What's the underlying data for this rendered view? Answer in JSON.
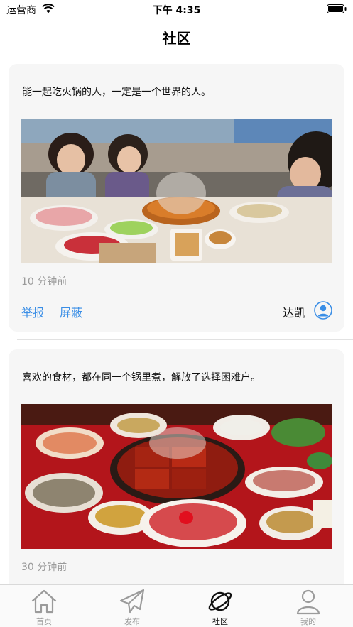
{
  "status_bar": {
    "carrier": "运营商",
    "time": "下午 4:35"
  },
  "nav": {
    "title": "社区"
  },
  "posts": [
    {
      "text": "能一起吃火锅的人，一定是一个世界的人。",
      "time": "10 分钟前",
      "report_label": "举报",
      "block_label": "屏蔽",
      "author": "达凯"
    },
    {
      "text": "喜欢的食材，都在同一个锅里煮，解放了选择困难户。",
      "time": "30 分钟前"
    }
  ],
  "tabs": [
    {
      "label": "首页",
      "icon": "home-icon",
      "active": false
    },
    {
      "label": "发布",
      "icon": "send-icon",
      "active": false
    },
    {
      "label": "社区",
      "icon": "planet-icon",
      "active": true
    },
    {
      "label": "我的",
      "icon": "user-icon",
      "active": false
    }
  ],
  "colors": {
    "accent_link": "#3a8ee6",
    "muted_text": "#9a9a9a",
    "card_background": "#f6f6f6",
    "avatar_blue": "#3a8ee6"
  }
}
